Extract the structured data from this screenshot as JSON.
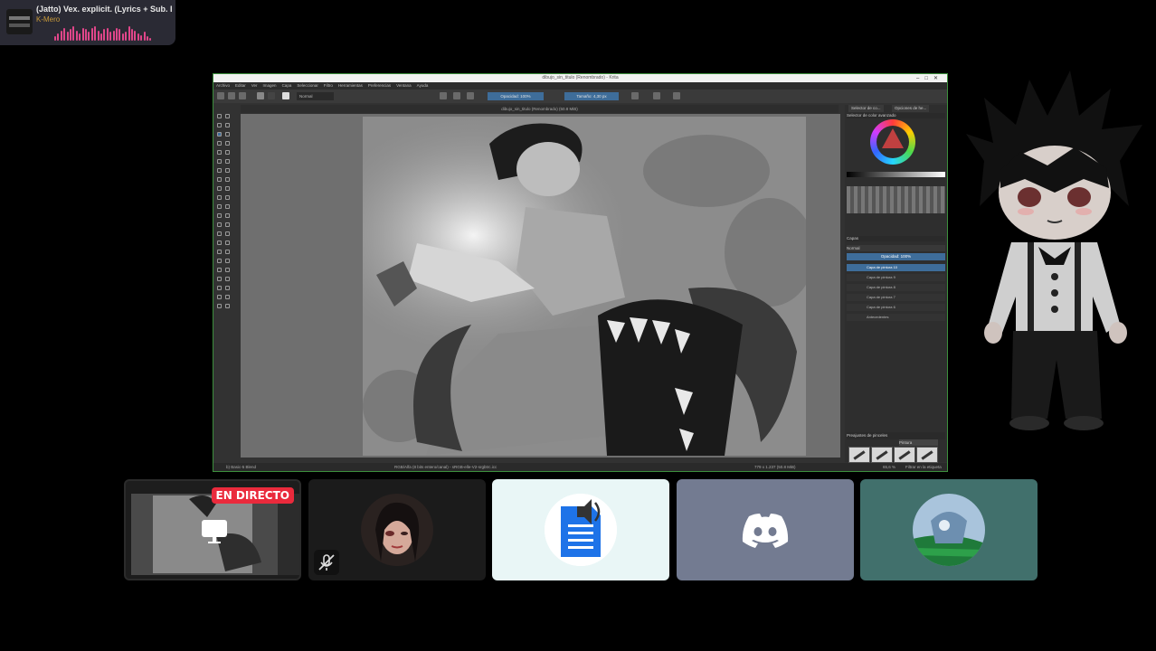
{
  "now_playing": {
    "title": "(Jatto) Vex. explicit. (Lyrics + Sub. Espa",
    "artist": "K-Mero",
    "visualizer_levels": [
      0.3,
      0.5,
      0.7,
      0.9,
      0.6,
      0.8,
      1.0,
      0.7,
      0.5,
      0.9,
      0.8,
      0.6,
      0.9,
      1.0,
      0.7,
      0.5,
      0.8,
      0.9,
      0.6,
      0.7,
      0.9,
      0.8,
      0.5,
      0.6,
      1.0,
      0.8,
      0.7,
      0.5,
      0.4,
      0.6,
      0.3,
      0.2
    ],
    "accent_color": "#e0468a"
  },
  "app": {
    "title": "dibujo_sin_titulo (Renombrado) - Krita",
    "menu": [
      "Archivo",
      "Editar",
      "Ver",
      "Imagen",
      "Capa",
      "Seleccionar",
      "Filtro",
      "Herramientas",
      "Preferencias",
      "Ventana",
      "Ayuda"
    ],
    "blend_mode": "Normal",
    "opacity": "Opacidad: 100%",
    "size": "Tamaño: 4,30 px",
    "doc_tab": "dibujo_sin_titulo (Renombrado) (50.8 MiB)",
    "dock_tabs": [
      "Selector de co...",
      "Opciones de he..."
    ],
    "color_section": "Selector de color avanzado",
    "layers_title": "Capas",
    "layers_blend": "Normal",
    "layers_opacity": "Opacidad: 100%",
    "layers": [
      {
        "name": "Capa de pintura 10",
        "selected": true
      },
      {
        "name": "Capa de pintura 9",
        "selected": false
      },
      {
        "name": "Capa de pintura 8",
        "selected": false
      },
      {
        "name": "Capa de pintura 7",
        "selected": false
      },
      {
        "name": "Capa de pintura 6",
        "selected": false
      },
      {
        "name": "Antecedentes",
        "selected": false
      }
    ],
    "brushes_title": "Preajustes de pinceles",
    "brush_tag": "Pintura",
    "status_left": "b) Basic-5 Blend",
    "status_center": "RGB/Alfa (8 bits entero/canal) - sRGB-elle-V2-srgbtrc.icc",
    "status_right": "779 x 1.237 (50.8 MiB)",
    "zoom": "65,6 %",
    "status_filter": "Filtrar en la etiqueta"
  },
  "tiles": {
    "stream_badge": "EN DIRECTO"
  },
  "colors": {
    "window_border": "#3c8f3c",
    "live_badge": "#ea2a3c",
    "discord_tile": "#737b91",
    "green_tile": "#41706c"
  }
}
